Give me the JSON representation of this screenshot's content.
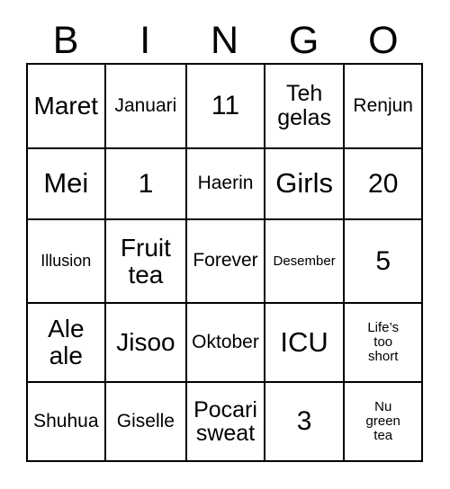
{
  "card": {
    "title": "BINGO",
    "headers": [
      "B",
      "I",
      "N",
      "G",
      "O"
    ],
    "rows": [
      [
        {
          "text": "Maret",
          "size": "xl"
        },
        {
          "text": "Januari",
          "size": "md"
        },
        {
          "text": "11",
          "size": "num"
        },
        {
          "text": "Teh\ngelas",
          "size": "lg"
        },
        {
          "text": "Renjun",
          "size": "md"
        }
      ],
      [
        {
          "text": "Mei",
          "size": "xxl"
        },
        {
          "text": "1",
          "size": "num"
        },
        {
          "text": "Haerin",
          "size": "md"
        },
        {
          "text": "Girls",
          "size": "xxl"
        },
        {
          "text": "20",
          "size": "num"
        }
      ],
      [
        {
          "text": "Illusion",
          "size": "sm"
        },
        {
          "text": "Fruit\ntea",
          "size": "xl"
        },
        {
          "text": "Forever",
          "size": "md"
        },
        {
          "text": "Desember",
          "size": "xs"
        },
        {
          "text": "5",
          "size": "num"
        }
      ],
      [
        {
          "text": "Ale\nale",
          "size": "xl"
        },
        {
          "text": "Jisoo",
          "size": "xl"
        },
        {
          "text": "Oktober",
          "size": "md"
        },
        {
          "text": "ICU",
          "size": "xxl"
        },
        {
          "text": "Life’s\ntoo\nshort",
          "size": "xs"
        }
      ],
      [
        {
          "text": "Shuhua",
          "size": "md"
        },
        {
          "text": "Giselle",
          "size": "md"
        },
        {
          "text": "Pocari\nsweat",
          "size": "lg"
        },
        {
          "text": "3",
          "size": "num"
        },
        {
          "text": "Nu\ngreen\ntea",
          "size": "xs"
        }
      ]
    ],
    "colors": {
      "background": "#ffffff",
      "border": "#000000",
      "text": "#000000"
    }
  }
}
